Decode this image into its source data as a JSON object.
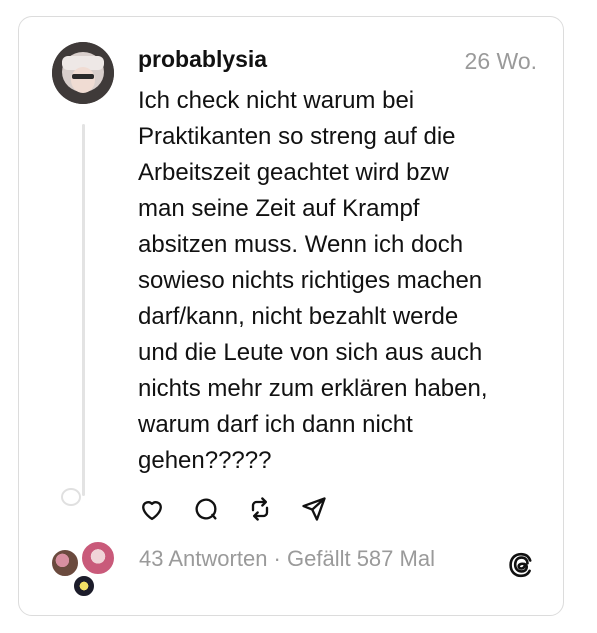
{
  "post": {
    "username": "probablysia",
    "time": "26 Wo.",
    "text": "Ich check nicht warum bei\nPraktikanten so streng auf die\nArbeitszeit geachtet wird bzw\nman seine Zeit auf Krampf\nabsitzen muss. Wenn ich doch\nsowieso nichts richtiges machen\ndarf/kann, nicht bezahlt werde\nund die Leute von sich aus auch\nnichts mehr zum erklären haben,\nwarum darf ich dann nicht\ngehen?????"
  },
  "stats": {
    "replies": "43 Antworten",
    "separator": " · ",
    "likes": "Gefällt 587 Mal"
  },
  "icons": {
    "like": "heart-icon",
    "comment": "comment-icon",
    "repost": "repost-icon",
    "share": "share-icon",
    "brand": "threads-logo"
  }
}
